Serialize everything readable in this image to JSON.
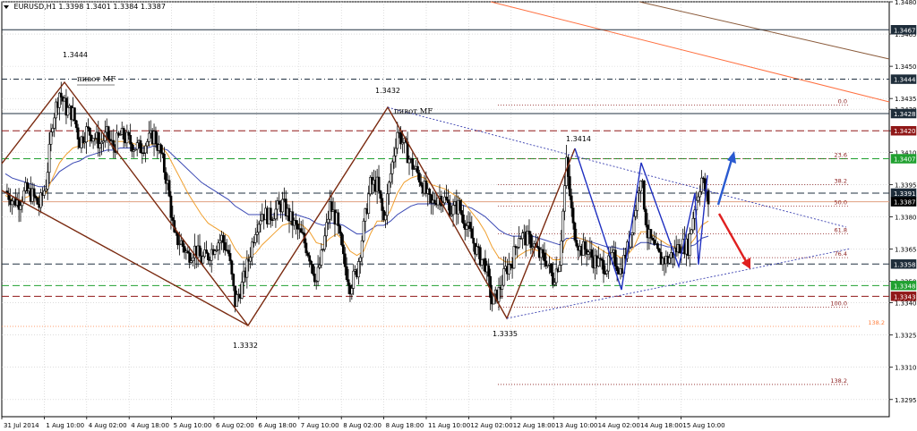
{
  "header": {
    "symbol": "EURUSD,H1",
    "ohlc": "1.3398 1.3401 1.3384 1.3387"
  },
  "colors": {
    "background": "#ffffff",
    "grid": "#c8c8c8",
    "candle": "#000000",
    "ma_fast": "#f0a030",
    "ma_slow": "#3c4ab4",
    "level_dark": "#203040",
    "level_green": "#20a030",
    "level_red": "#901818",
    "fib": "#8a1c1c",
    "pivot_brown": "#7a2a10",
    "wave_blue": "#2030c0",
    "arrow_blue": "#2a5ad0",
    "arrow_red": "#e02020",
    "trend_orange": "#ff7040",
    "trend_brown": "#8a5a3a",
    "dotted_blue": "#3a40b0",
    "orange_dots": "#ff8040"
  },
  "chart_data": {
    "type": "candlestick",
    "title": "EURUSD,H1 1.3398 1.3401 1.3384 1.3387",
    "ylim": [
      1.3287,
      1.348
    ],
    "grid": true,
    "y_ticks": [
      "1.3480",
      "1.3465",
      "1.3450",
      "1.3435",
      "1.3430",
      "1.3420",
      "1.3410",
      "1.3395",
      "1.3380",
      "1.3365",
      "1.3350",
      "1.3340",
      "1.3325",
      "1.3310",
      "1.3295"
    ],
    "x_tick_labels": [
      "31 Jul 2014",
      "1 Aug 10:00",
      "4 Aug 02:00",
      "4 Aug 18:00",
      "5 Aug 10:00",
      "6 Aug 02:00",
      "6 Aug 18:00",
      "7 Aug 10:00",
      "8 Aug 02:00",
      "8 Aug 18:00",
      "11 Aug 10:00",
      "12 Aug 02:00",
      "12 Aug 18:00",
      "13 Aug 10:00",
      "14 Aug 02:00",
      "14 Aug 18:00",
      "15 Aug 10:00"
    ],
    "close_path": [
      1.3392,
      1.3388,
      1.3387,
      1.3392,
      1.339,
      1.3385,
      1.3395,
      1.3425,
      1.3438,
      1.343,
      1.3428,
      1.3415,
      1.342,
      1.3418,
      1.3414,
      1.3418,
      1.3412,
      1.3418,
      1.3416,
      1.3413,
      1.3412,
      1.3415,
      1.3418,
      1.3409,
      1.3395,
      1.337,
      1.3368,
      1.3362,
      1.3365,
      1.336,
      1.3362,
      1.3367,
      1.337,
      1.3363,
      1.334,
      1.3348,
      1.336,
      1.3375,
      1.3382,
      1.338,
      1.3383,
      1.3386,
      1.338,
      1.3375,
      1.337,
      1.3362,
      1.335,
      1.3365,
      1.3385,
      1.3378,
      1.336,
      1.3348,
      1.3355,
      1.3375,
      1.3395,
      1.3395,
      1.3378,
      1.34,
      1.342,
      1.3413,
      1.3405,
      1.34,
      1.3393,
      1.3385,
      1.339,
      1.3388,
      1.3383,
      1.3385,
      1.3378,
      1.337,
      1.3362,
      1.3358,
      1.334,
      1.3345,
      1.3355,
      1.336,
      1.3372,
      1.337,
      1.3368,
      1.3362,
      1.336,
      1.3351,
      1.336,
      1.3405,
      1.3375,
      1.3365,
      1.3365,
      1.336,
      1.3358,
      1.3357,
      1.3361,
      1.3355,
      1.3365,
      1.338,
      1.34,
      1.3372,
      1.3365,
      1.336,
      1.336,
      1.3364,
      1.3367,
      1.3366,
      1.3385,
      1.3398,
      1.3387
    ],
    "ma_fast": [
      1.339,
      1.3388,
      1.3387,
      1.3389,
      1.339,
      1.3389,
      1.3391,
      1.3398,
      1.3405,
      1.3409,
      1.3412,
      1.3413,
      1.3415,
      1.3416,
      1.3416,
      1.3416,
      1.3415,
      1.3415,
      1.3415,
      1.3414,
      1.3413,
      1.3413,
      1.3414,
      1.3413,
      1.3409,
      1.3403,
      1.3397,
      1.3391,
      1.3386,
      1.3381,
      1.3377,
      1.3375,
      1.3373,
      1.3371,
      1.3365,
      1.3361,
      1.3361,
      1.3363,
      1.3367,
      1.337,
      1.3373,
      1.3376,
      1.3377,
      1.3377,
      1.3376,
      1.3373,
      1.3368,
      1.3367,
      1.337,
      1.3372,
      1.3369,
      1.3364,
      1.3362,
      1.3364,
      1.3372,
      1.3378,
      1.3378,
      1.3383,
      1.3391,
      1.3396,
      1.3398,
      1.3399,
      1.3398,
      1.3395,
      1.3394,
      1.3393,
      1.3391,
      1.3389,
      1.3386,
      1.3382,
      1.3378,
      1.3373,
      1.3366,
      1.3361,
      1.3359,
      1.3359,
      1.3362,
      1.3364,
      1.3365,
      1.3364,
      1.3363,
      1.336,
      1.336,
      1.3369,
      1.3371,
      1.337,
      1.3369,
      1.3367,
      1.3365,
      1.3363,
      1.3363,
      1.3361,
      1.3362,
      1.3366,
      1.3373,
      1.3373,
      1.3371,
      1.3369,
      1.3367,
      1.3366,
      1.3366,
      1.3366,
      1.337,
      1.3376,
      1.3378
    ],
    "ma_slow": [
      1.34,
      1.3398,
      1.3397,
      1.3396,
      1.3395,
      1.3394,
      1.3394,
      1.3397,
      1.3401,
      1.3403,
      1.3405,
      1.3406,
      1.3408,
      1.3409,
      1.341,
      1.3411,
      1.3411,
      1.3412,
      1.3412,
      1.3412,
      1.3412,
      1.3412,
      1.3413,
      1.3412,
      1.3411,
      1.3408,
      1.3405,
      1.3402,
      1.3399,
      1.3396,
      1.3394,
      1.3392,
      1.339,
      1.3388,
      1.3385,
      1.3383,
      1.3381,
      1.3381,
      1.3381,
      1.3381,
      1.3381,
      1.3381,
      1.3381,
      1.3381,
      1.338,
      1.3379,
      1.3377,
      1.3376,
      1.3377,
      1.3377,
      1.3376,
      1.3374,
      1.3372,
      1.3372,
      1.3374,
      1.3376,
      1.3376,
      1.3378,
      1.3381,
      1.3383,
      1.3385,
      1.3386,
      1.3386,
      1.3386,
      1.3386,
      1.3386,
      1.3386,
      1.3386,
      1.3385,
      1.3384,
      1.3382,
      1.338,
      1.3377,
      1.3374,
      1.3372,
      1.3371,
      1.3371,
      1.3371,
      1.3371,
      1.337,
      1.3369,
      1.3368,
      1.3367,
      1.337,
      1.337,
      1.337,
      1.3369,
      1.3368,
      1.3367,
      1.3366,
      1.3366,
      1.3365,
      1.3365,
      1.3366,
      1.3368,
      1.3368,
      1.3367,
      1.3367,
      1.3366,
      1.3366,
      1.3366,
      1.3366,
      1.3367,
      1.337,
      1.3371
    ],
    "levels": [
      {
        "price": 1.3467,
        "label": "1.3467",
        "style": "solid",
        "kind": "dark"
      },
      {
        "price": 1.3444,
        "label": "1.3444",
        "style": "dashdot",
        "kind": "dark"
      },
      {
        "price": 1.3428,
        "label": "1.3428",
        "style": "solid",
        "kind": "dark"
      },
      {
        "price": 1.342,
        "label": "1.3420",
        "style": "dashed",
        "kind": "red"
      },
      {
        "price": 1.3407,
        "label": "1.3407",
        "style": "dashed",
        "kind": "green"
      },
      {
        "price": 1.3391,
        "label": "1.3391",
        "style": "dashed",
        "kind": "dark"
      },
      {
        "price": 1.3387,
        "label": "1.3387",
        "style": "solid",
        "kind": "current"
      },
      {
        "price": 1.3358,
        "label": "1.3358",
        "style": "dashed",
        "kind": "dark"
      },
      {
        "price": 1.3348,
        "label": "1.3348",
        "style": "dashed",
        "kind": "green"
      },
      {
        "price": 1.3343,
        "label": "1.3343",
        "style": "dashed",
        "kind": "red"
      }
    ],
    "fib_levels": [
      {
        "label": "0.0",
        "price": 1.3432
      },
      {
        "label": "23.6",
        "price": 1.3407
      },
      {
        "label": "38.2",
        "price": 1.3395
      },
      {
        "label": "50.0",
        "price": 1.3385
      },
      {
        "label": "61.8",
        "price": 1.3372
      },
      {
        "label": "76.4",
        "price": 1.3361
      },
      {
        "label": "100.0",
        "price": 1.3338
      },
      {
        "label": "138.2",
        "price": 1.3302
      }
    ],
    "annotations": [
      {
        "text": "1.3444"
      },
      {
        "text": "пивот MF"
      },
      {
        "text": "1.3432"
      },
      {
        "text": "пивот MF"
      },
      {
        "text": "1.3414"
      },
      {
        "text": "1.3332"
      },
      {
        "text": "1.3335"
      },
      {
        "text": "138.2"
      }
    ]
  }
}
